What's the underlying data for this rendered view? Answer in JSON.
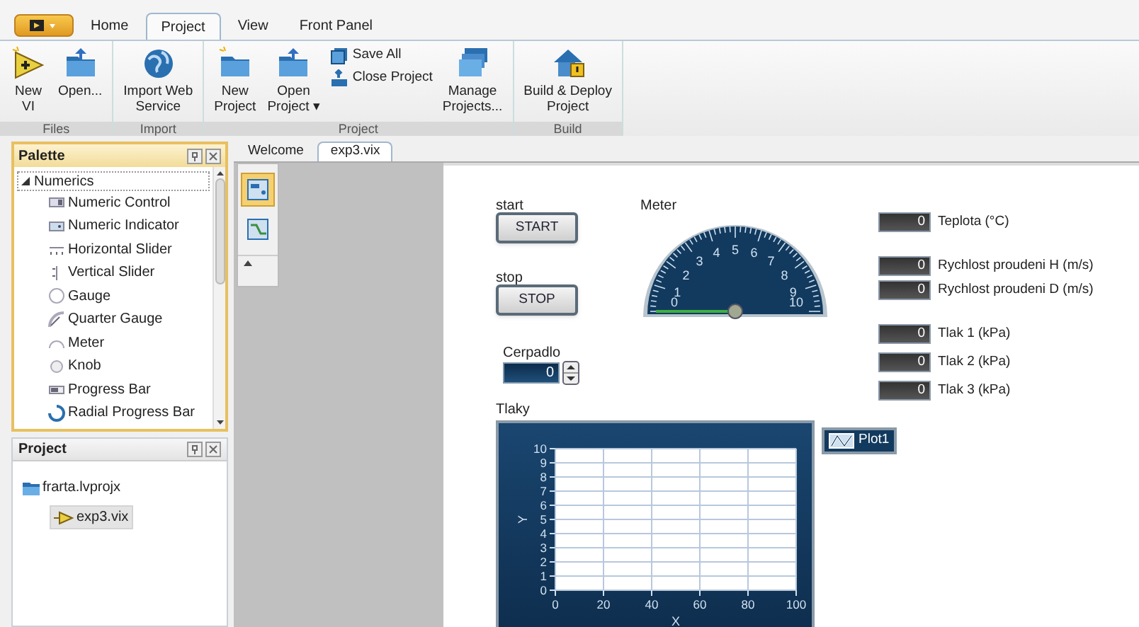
{
  "ribbon": {
    "tabs": [
      {
        "label": "Home",
        "selected": false
      },
      {
        "label": "Project",
        "selected": true
      },
      {
        "label": "View",
        "selected": false
      },
      {
        "label": "Front Panel",
        "selected": false
      }
    ],
    "groups": [
      {
        "label": "Files",
        "buttons": [
          {
            "kind": "large",
            "label": "New\nVI"
          },
          {
            "kind": "large",
            "label": "Open..."
          }
        ]
      },
      {
        "label": "Import",
        "buttons": [
          {
            "kind": "large",
            "label": "Import Web\nService"
          }
        ]
      },
      {
        "label": "Project",
        "buttons": [
          {
            "kind": "large",
            "label": "New\nProject"
          },
          {
            "kind": "large",
            "label": "Open\nProject ▾"
          },
          {
            "kind": "small",
            "label": "Save All"
          },
          {
            "kind": "small",
            "label": "Close Project"
          },
          {
            "kind": "large",
            "label": "Manage\nProjects..."
          }
        ]
      },
      {
        "label": "Build",
        "buttons": [
          {
            "kind": "large",
            "label": "Build & Deploy\nProject"
          }
        ]
      }
    ]
  },
  "palette": {
    "title": "Palette",
    "items": [
      {
        "label": "Numerics",
        "expanded": true,
        "children": [
          {
            "label": "Numeric Control"
          },
          {
            "label": "Numeric Indicator"
          },
          {
            "label": "Horizontal Slider"
          },
          {
            "label": "Vertical Slider"
          },
          {
            "label": "Gauge"
          },
          {
            "label": "Quarter Gauge"
          },
          {
            "label": "Meter"
          },
          {
            "label": "Knob"
          },
          {
            "label": "Progress Bar"
          },
          {
            "label": "Radial Progress Bar"
          }
        ]
      }
    ]
  },
  "project": {
    "title": "Project",
    "items": [
      {
        "label": "frarta.lvprojx",
        "selected": false,
        "children": [
          {
            "label": "exp3.vix",
            "selected": true
          }
        ]
      }
    ]
  },
  "doc_tabs": [
    {
      "label": "Welcome",
      "selected": false
    },
    {
      "label": "exp3.vix",
      "selected": true
    }
  ],
  "view_toggle": [
    {
      "selected": true
    },
    {
      "selected": false
    }
  ],
  "front_panel": {
    "buttons": [
      {
        "caption": "start",
        "label": "START"
      },
      {
        "caption": "stop",
        "label": "STOP"
      }
    ],
    "control": {
      "caption": "Cerpadlo",
      "value": "0"
    },
    "meter": {
      "caption": "Meter",
      "scale": [
        "0",
        "1",
        "2",
        "3",
        "4",
        "5",
        "6",
        "7",
        "8",
        "9",
        "10"
      ]
    },
    "indicators": [
      {
        "value": "0",
        "label": "Teplota (°C)"
      },
      {
        "value": "0",
        "label": "Rychlost proudeni H (m/s)"
      },
      {
        "value": "0",
        "label": "Rychlost proudeni D (m/s)"
      },
      {
        "value": "0",
        "label": "Tlak 1 (kPa)"
      },
      {
        "value": "0",
        "label": "Tlak 2 (kPa)"
      },
      {
        "value": "0",
        "label": "Tlak 3 (kPa)"
      }
    ],
    "graph": {
      "caption": "Tlaky",
      "chart_data": {
        "type": "line",
        "xlabel": "X",
        "ylabel": "Y",
        "categories": [
          "0",
          "20",
          "40",
          "60",
          "80",
          "100"
        ],
        "ylim": [
          0,
          10
        ],
        "yticks": [
          0,
          1,
          2,
          3,
          4,
          5,
          6,
          7,
          8,
          9,
          10
        ],
        "grid": true,
        "series": [
          {
            "name": "Plot1",
            "color": "#ffffff",
            "values": [
              null,
              null,
              null,
              null,
              null,
              null
            ]
          }
        ]
      }
    }
  }
}
